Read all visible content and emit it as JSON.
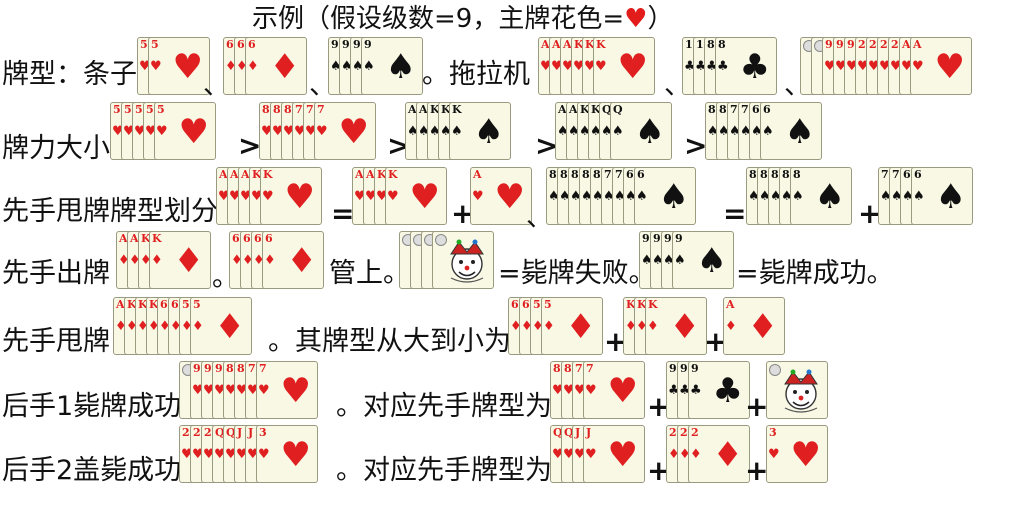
{
  "title": {
    "prefix": "示例（假设级数=9，主牌花色=",
    "heart": "♥",
    "suffix": "）"
  },
  "labels": {
    "pattern": "牌型：条子",
    "tractor": "。拖拉机",
    "strength": "牌力大小",
    "split": "先手甩牌牌型划分",
    "lead": "先手出牌",
    "lead_mid": "。",
    "lead_cover": "管上。",
    "kill_fail": "=毙牌失败。",
    "kill_ok": "=毙牌成功。",
    "throw": "先手甩牌",
    "throw_desc": "。其牌型从大到小为",
    "f1": "后手1毙牌成功",
    "f2": "后手2盖毙成功",
    "corr": "。对应先手牌型为"
  },
  "symbols": {
    "comma": "、",
    "plus": "+",
    "eq": "=",
    "gt": ">"
  },
  "hands": {
    "r1a": {
      "suit": "♥",
      "ranks": [
        "5",
        "5"
      ]
    },
    "r1b": {
      "suit": "♦",
      "ranks": [
        "6",
        "6",
        "6"
      ]
    },
    "r1c": {
      "suit": "♠",
      "ranks": [
        "9",
        "9",
        "9",
        "9"
      ]
    },
    "r1d": {
      "suit": "♥",
      "ranks": [
        "A",
        "A",
        "A",
        "K",
        "K",
        "K"
      ]
    },
    "r1e": {
      "suit": "♣",
      "ranks": [
        "10",
        "10",
        "8",
        "8"
      ]
    },
    "r1f": {
      "suit": "♥",
      "ranks": [
        "JK",
        "JK",
        "9",
        "9",
        "9",
        "2",
        "2",
        "2",
        "2",
        "A",
        "A"
      ]
    },
    "r2a": {
      "suit": "♥",
      "ranks": [
        "5",
        "5",
        "5",
        "5",
        "5"
      ]
    },
    "r2b": {
      "suit": "♥",
      "ranks": [
        "8",
        "8",
        "8",
        "7",
        "7",
        "7"
      ]
    },
    "r2c": {
      "suit": "♠",
      "ranks": [
        "A",
        "A",
        "K",
        "K",
        "K"
      ]
    },
    "r2d": {
      "suit": "♠",
      "ranks": [
        "A",
        "A",
        "K",
        "K",
        "Q",
        "Q"
      ]
    },
    "r2e": {
      "suit": "♠",
      "ranks": [
        "8",
        "8",
        "7",
        "7",
        "6",
        "6"
      ]
    },
    "r3a": {
      "suit": "♥",
      "ranks": [
        "A",
        "A",
        "A",
        "K",
        "K"
      ]
    },
    "r3b": {
      "suit": "♥",
      "ranks": [
        "A",
        "A",
        "K",
        "K"
      ]
    },
    "r3c": {
      "suit": "♥",
      "ranks": [
        "A"
      ]
    },
    "r3d": {
      "suit": "♠",
      "ranks": [
        "8",
        "8",
        "8",
        "8",
        "8",
        "7",
        "7",
        "6",
        "6"
      ]
    },
    "r3e": {
      "suit": "♠",
      "ranks": [
        "8",
        "8",
        "8",
        "8",
        "8"
      ]
    },
    "r3f": {
      "suit": "♠",
      "ranks": [
        "7",
        "7",
        "6",
        "6"
      ]
    },
    "r4a": {
      "suit": "♦",
      "ranks": [
        "A",
        "A",
        "K",
        "K"
      ]
    },
    "r4b": {
      "suit": "♦",
      "ranks": [
        "6",
        "6",
        "6",
        "6"
      ]
    },
    "r4c": {
      "suit": "joker",
      "ranks": [
        "JK",
        "JK",
        "JK",
        "JK"
      ]
    },
    "r4d": {
      "suit": "♠",
      "ranks": [
        "9",
        "9",
        "9",
        "9"
      ]
    },
    "r5a": {
      "suit": "♦",
      "ranks": [
        "A",
        "K",
        "K",
        "K",
        "6",
        "6",
        "5",
        "5"
      ]
    },
    "r5b": {
      "suit": "♦",
      "ranks": [
        "6",
        "6",
        "5",
        "5"
      ]
    },
    "r5c": {
      "suit": "♦",
      "ranks": [
        "K",
        "K",
        "K"
      ]
    },
    "r5d": {
      "suit": "♦",
      "ranks": [
        "A"
      ]
    },
    "r6a": {
      "suit": "♥",
      "ranks": [
        "JK",
        "9",
        "9",
        "9",
        "8",
        "8",
        "7",
        "7"
      ]
    },
    "r6b": {
      "suit": "♥",
      "ranks": [
        "8",
        "8",
        "7",
        "7"
      ]
    },
    "r6c": {
      "suit": "♣",
      "ranks": [
        "9",
        "9",
        "9"
      ]
    },
    "r6d": {
      "suit": "joker",
      "ranks": [
        "JK"
      ]
    },
    "r7a": {
      "suit": "♥",
      "ranks": [
        "2",
        "2",
        "2",
        "Q",
        "Q",
        "J",
        "J",
        "3"
      ]
    },
    "r7b": {
      "suit": "♥",
      "ranks": [
        "Q",
        "Q",
        "J",
        "J"
      ]
    },
    "r7c": {
      "suit": "♦",
      "ranks": [
        "2",
        "2",
        "2"
      ]
    },
    "r7d": {
      "suit": "♥",
      "ranks": [
        "3"
      ]
    }
  },
  "colors": {
    "red": "#e02020",
    "black": "#111111",
    "card_bg": "#f8f8e4"
  }
}
